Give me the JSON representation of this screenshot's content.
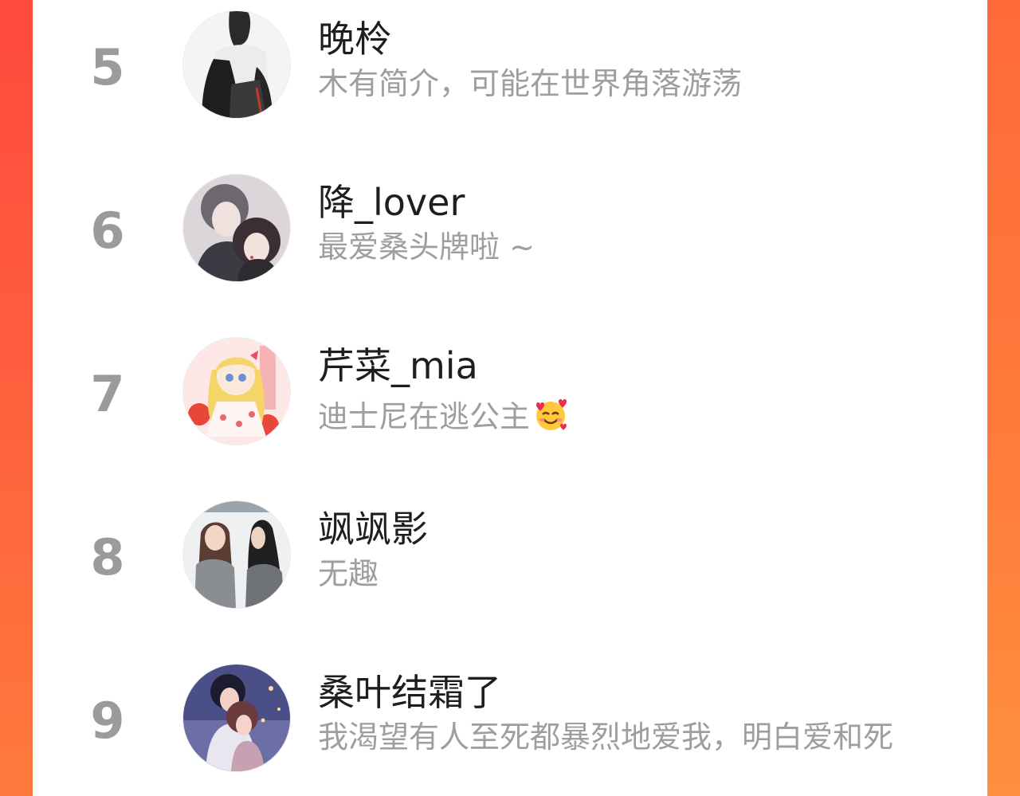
{
  "ranking": {
    "items": [
      {
        "rank": "5",
        "name": "晚柃",
        "bio": "木有简介，可能在世界角落游荡"
      },
      {
        "rank": "6",
        "name": "降_lover",
        "bio": "最爱桑头牌啦 ~"
      },
      {
        "rank": "7",
        "name": "芹菜_mia",
        "bio": "迪士尼在逃公主",
        "bio_emoji": "smiling-face-with-hearts-icon"
      },
      {
        "rank": "8",
        "name": "飒飒影",
        "bio": "无趣"
      },
      {
        "rank": "9",
        "name": "桑叶结霜了",
        "bio": "我渴望有人至死都暴烈地爱我，明白爱和死"
      }
    ]
  },
  "colors": {
    "background_gradient_start": "#ff4a3d",
    "background_gradient_end": "#ff7a3c",
    "card": "#ffffff",
    "rank_text": "#9b9b9b",
    "name_text": "#1e1e1e",
    "bio_text": "#9e9e9e"
  }
}
